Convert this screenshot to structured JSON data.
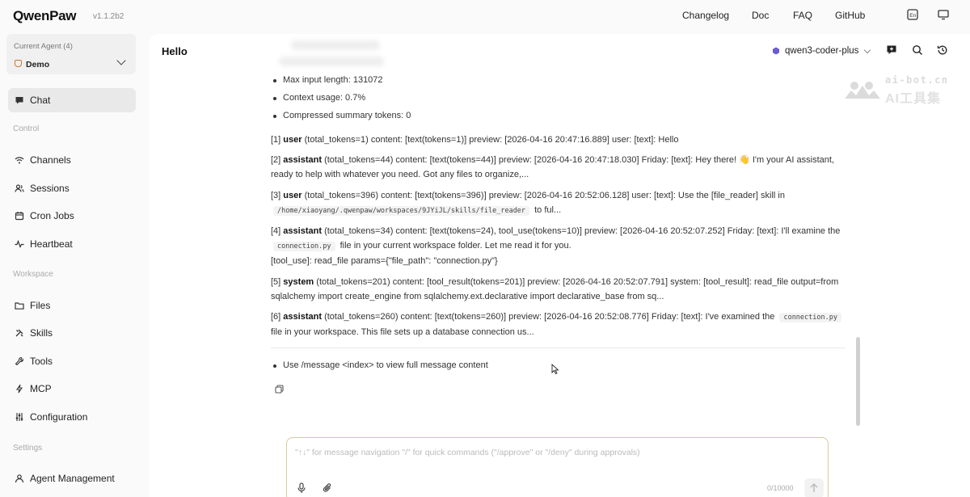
{
  "app": {
    "name": "QwenPaw",
    "version": "v1.1.2b2"
  },
  "topnav": {
    "changelog": "Changelog",
    "doc": "Doc",
    "faq": "FAQ",
    "github": "GitHub"
  },
  "sidebar": {
    "agent_label": "Current Agent (4)",
    "agent_name": "Demo",
    "chat": "Chat",
    "section_control": "Control",
    "channels": "Channels",
    "sessions": "Sessions",
    "cron_jobs": "Cron Jobs",
    "heartbeat": "Heartbeat",
    "section_workspace": "Workspace",
    "files": "Files",
    "skills": "Skills",
    "tools": "Tools",
    "mcp": "MCP",
    "configuration": "Configuration",
    "section_settings": "Settings",
    "agent_management": "Agent Management"
  },
  "chat": {
    "title": "Hello",
    "model": "qwen3-coder-plus",
    "bullets_top": [
      "Max input length: 131072",
      "Context usage: 0.7%",
      "Compressed summary tokens: 0"
    ],
    "messages": [
      {
        "idx": "[1]",
        "role": "user",
        "meta": "(total_tokens=1) content: [text(tokens=1)] preview: [2026-04-16 20:47:16.889] user: [text]: Hello"
      },
      {
        "idx": "[2]",
        "role": "assistant",
        "meta": "(total_tokens=44) content: [text(tokens=44)] preview: [2026-04-16 20:47:18.030] Friday: [text]: Hey there! 👋 I'm your AI assistant,",
        "line2": "ready to help with whatever you need. Got any files to organize,..."
      },
      {
        "idx": "[3]",
        "role": "user",
        "meta": "(total_tokens=396) content: [text(tokens=396)] preview: [2026-04-16 20:52:06.128] user: [text]: Use the [file_reader] skill in",
        "code": "/home/xiaoyang/.qwenpaw/workspaces/9JYiJL/skills/file_reader",
        "tail": "to ful..."
      },
      {
        "idx": "[4]",
        "role": "assistant",
        "meta": "(total_tokens=34) content: [text(tokens=24), tool_use(tokens=10)] preview: [2026-04-16 20:52:07.252] Friday: [text]: I'll examine the",
        "code": "connection.py",
        "tail": "file in your current workspace folder. Let me read it for you.",
        "line3": "[tool_use]: read_file params={\"file_path\": \"connection.py\"}"
      },
      {
        "idx": "[5]",
        "role": "system",
        "meta": "(total_tokens=201) content: [tool_result(tokens=201)] preview: [2026-04-16 20:52:07.791] system: [tool_result]: read_file output=from",
        "line2": "sqlalchemy import create_engine from sqlalchemy.ext.declarative import declarative_base from sq..."
      },
      {
        "idx": "[6]",
        "role": "assistant",
        "meta": "(total_tokens=260) content: [text(tokens=260)] preview: [2026-04-16 20:52:08.776] Friday: [text]: I've examined the",
        "code": "connection.py",
        "line2": "file in your workspace. This file sets up a database connection us..."
      }
    ],
    "bullet_bottom": "Use /message <index> to view full message content"
  },
  "watermark": {
    "site": "ai-bot.cn",
    "label": "AI工具集"
  },
  "composer": {
    "placeholder": "\"↑↓\" for message navigation   \"/\" for quick commands (\"/approve\" or \"/deny\" during approvals)",
    "counter": "0/10000"
  },
  "colors": {
    "accent_border": "#d8c9a0",
    "active_nav": "#e9e9e9",
    "background": "#fafafa"
  }
}
